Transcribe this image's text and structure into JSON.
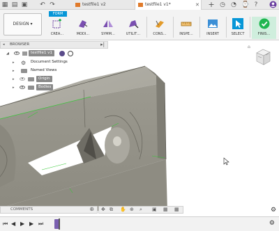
{
  "window": {
    "tabs": [
      {
        "label": "testfile1 v2",
        "active": false
      },
      {
        "label": "testfile1 v1*",
        "active": true
      }
    ],
    "new_tab": "+"
  },
  "toolbar": {
    "workspace": "DESIGN",
    "mode_tab": "FORM",
    "tools": [
      {
        "label": "CREA…"
      },
      {
        "label": "MODI…"
      },
      {
        "label": "SYMM…"
      },
      {
        "label": "UTILIT…"
      },
      {
        "label": "CONS…"
      },
      {
        "label": "INSPE…"
      },
      {
        "label": "INSERT"
      },
      {
        "label": "SELECT"
      },
      {
        "label": "FINIS…"
      }
    ]
  },
  "browser": {
    "title": "BROWSER",
    "root": "testfile1 v1",
    "items": [
      {
        "label": "Document Settings"
      },
      {
        "label": "Named Views"
      },
      {
        "label": "Origin"
      },
      {
        "label": "Bodies"
      }
    ]
  },
  "comments": {
    "label": "COMMENTS"
  },
  "colors": {
    "accent": "#0696d7",
    "finish": "#1fb650",
    "model": "#9c9a90",
    "edge_highlight": "#37c837"
  }
}
